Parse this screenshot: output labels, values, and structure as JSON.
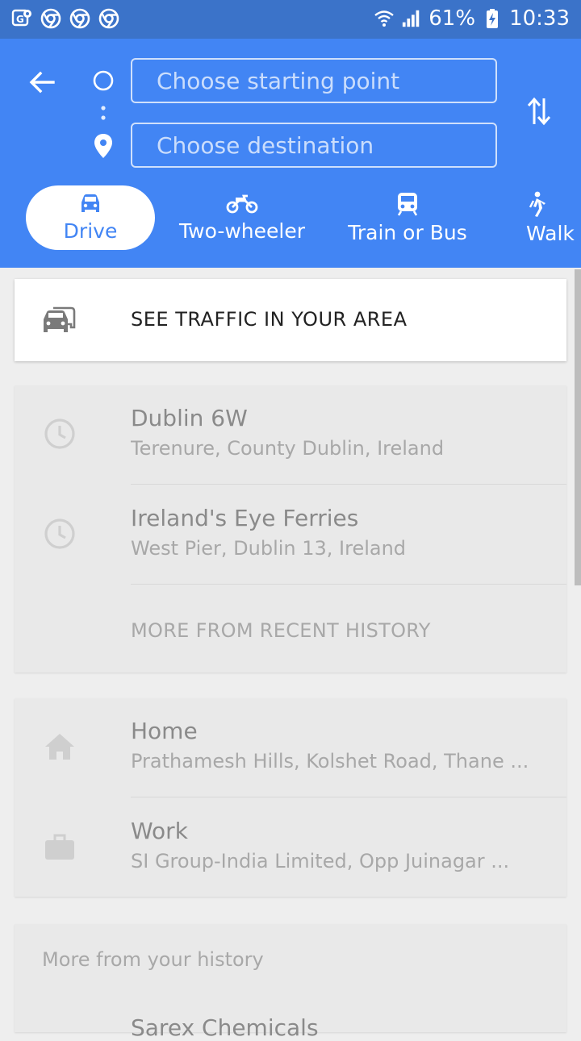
{
  "status_bar": {
    "battery": "61%",
    "time": "10:33",
    "left_icons": [
      "maps-notification-icon",
      "chrome-icon",
      "chrome-icon",
      "chrome-icon"
    ]
  },
  "search": {
    "start_placeholder": "Choose starting point",
    "destination_placeholder": "Choose destination"
  },
  "modes": [
    {
      "label": "Drive",
      "icon": "car-icon",
      "active": true
    },
    {
      "label": "Two-wheeler",
      "icon": "motorbike-icon",
      "active": false
    },
    {
      "label": "Train or Bus",
      "icon": "train-icon",
      "active": false
    },
    {
      "label": "Walk",
      "icon": "walk-icon",
      "active": false
    }
  ],
  "traffic": {
    "label": "SEE TRAFFIC IN YOUR AREA"
  },
  "recent": {
    "items": [
      {
        "title": "Dublin 6W",
        "subtitle": "Terenure, County Dublin, Ireland"
      },
      {
        "title": "Ireland's Eye Ferries",
        "subtitle": "West Pier, Dublin 13, Ireland"
      }
    ],
    "more_label": "MORE FROM RECENT HISTORY"
  },
  "saved": {
    "items": [
      {
        "title": "Home",
        "subtitle": "Prathamesh Hills, Kolshet Road, Thane ..."
      },
      {
        "title": "Work",
        "subtitle": "SI Group-India Limited, Opp Juinagar ..."
      }
    ]
  },
  "history": {
    "title": "More from your history",
    "peek_item": "Sarex Chemicals"
  },
  "colors": {
    "header": "#4285f4",
    "status_bar": "#3b73c9",
    "accent": "#4285f4"
  }
}
